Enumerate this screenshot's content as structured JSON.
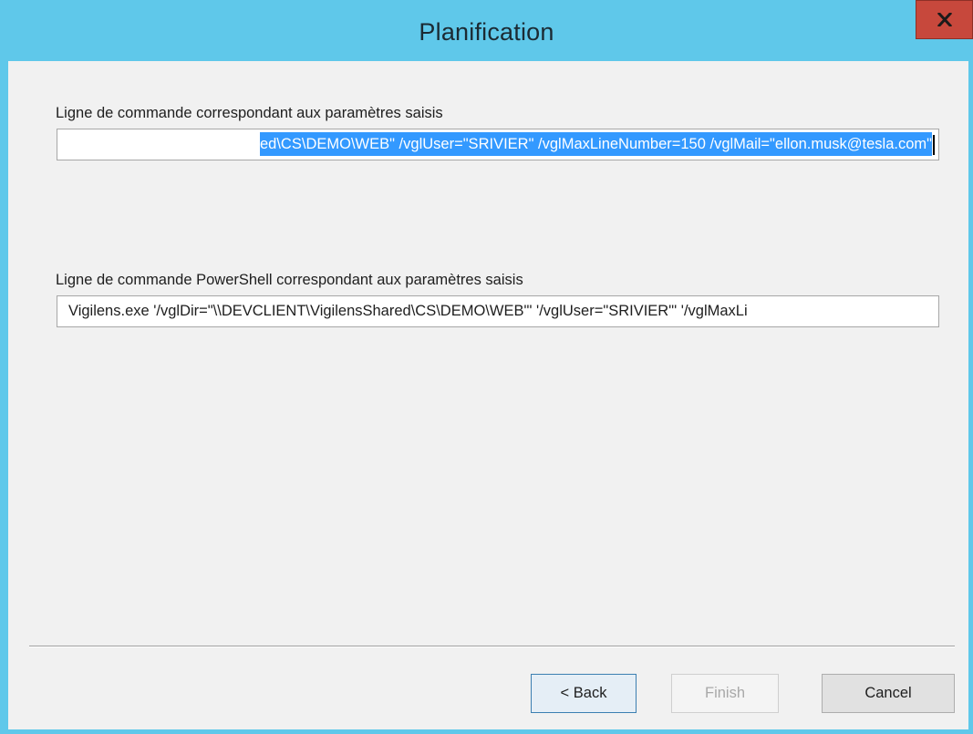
{
  "window": {
    "title": "Planification",
    "close_label": "x"
  },
  "colors": {
    "titlebar": "#5fc8ea",
    "close_button": "#c7483c",
    "selection": "#3399ff",
    "client_background": "#f1f1f1"
  },
  "command_line": {
    "label": "Ligne de commande correspondant aux paramètres saisis",
    "visible_value": "ed\\CS\\DEMO\\WEB\" /vglUser=\"SRIVIER\" /vglMaxLineNumber=150 /vglMail=\"ellon.musk@tesla.com\""
  },
  "powershell_line": {
    "label": "Ligne de commande PowerShell correspondant aux paramètres saisis",
    "visible_value": "Vigilens.exe '/vglDir=\"\\\\DEVCLIENT\\VigilensShared\\CS\\DEMO\\WEB\"' '/vglUser=\"SRIVIER\"' '/vglMaxLi"
  },
  "buttons": {
    "back": "< Back",
    "finish": "Finish",
    "cancel": "Cancel"
  }
}
